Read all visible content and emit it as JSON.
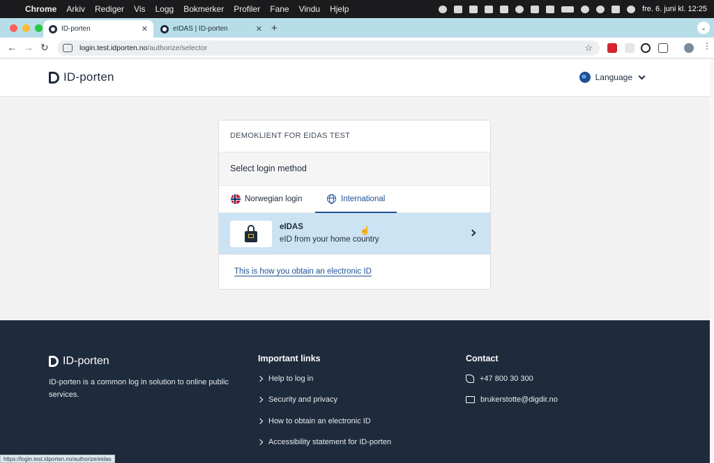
{
  "os_menubar": {
    "app_name": "Chrome",
    "menu_items": [
      "Arkiv",
      "Rediger",
      "Vis",
      "Logg",
      "Bokmerker",
      "Profiler",
      "Fane",
      "Vindu",
      "Hjelp"
    ],
    "clock": "fre. 6. juni kl. 12:25"
  },
  "browser": {
    "tabs": [
      {
        "title": "ID-porten"
      },
      {
        "title": "eIDAS | ID-porten"
      }
    ],
    "new_tab_label": "+",
    "address": {
      "host": "login.test.idporten.no",
      "path": "/authorize/selector"
    },
    "status_url": "https://login.test.idporten.no/authorize/eidas"
  },
  "header": {
    "logo_text": "ID-porten",
    "language_label": "Language"
  },
  "card": {
    "client_name": "DEMOKLIENT FOR EIDAS TEST",
    "heading": "Select login method",
    "tabs": [
      {
        "label": "Norwegian login",
        "active": false
      },
      {
        "label": "International",
        "active": true
      }
    ],
    "option": {
      "title": "eIDAS",
      "subtitle": "eID from your home country"
    },
    "obtain_link": "This is how you obtain an electronic ID"
  },
  "footer": {
    "logo_text": "ID-porten",
    "description": "ID-porten is a common log in solution to online public services.",
    "links_title": "Important links",
    "links": [
      "Help to log in",
      "Security and privacy",
      "How to obtain an electronic ID",
      "Accessibility statement for ID-porten"
    ],
    "contact_title": "Contact",
    "phone": "+47 800 30 300",
    "email": "brukerstotte@digdir.no"
  },
  "colors": {
    "primary": "#1e2b3c",
    "accent_blue": "#1e4f93",
    "option_highlight": "#cce3f4",
    "tabstrip": "#b7dde8"
  }
}
